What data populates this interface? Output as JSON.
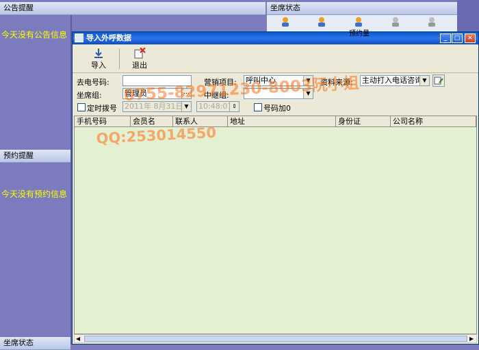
{
  "left": {
    "announcement_header": "公告提醒",
    "announcement_text": "今天没有公告信息",
    "reservation_header": "预约提醒",
    "reservation_text": "今天没有预约信息",
    "bottom_header": "坐席状态"
  },
  "agents": {
    "header": "坐席状态",
    "icons": [
      "agent-online-icon",
      "agent-online-icon",
      "agent-online-icon",
      "agent-offline-icon",
      "agent-offline-icon"
    ],
    "labels": [
      "",
      "",
      "预约量",
      "",
      ""
    ]
  },
  "dialog": {
    "title": "导入外呼数据",
    "toolbar": {
      "import_label": "导入",
      "exit_label": "退出"
    },
    "form": {
      "phone_label": "去电号码:",
      "phone_value": "",
      "marketing_label": "营销项目:",
      "marketing_value": "呼叫中心",
      "source_label": "资料来源:",
      "source_value": "主动打入电话咨询",
      "group_label": "坐席组:",
      "group_value": "管理员",
      "trunk_label": "中继组:",
      "trunk_value": "",
      "timed_dial_label": "定时拨号",
      "timed_date_value": "2011年 8月31日",
      "timed_time_value": "10:48:07",
      "add_prefix_label": "号码加0"
    },
    "grid": {
      "columns": [
        "手机号码",
        "会员名",
        "联系人",
        "地址",
        "身份证",
        "公司名称"
      ]
    }
  },
  "watermark": {
    "phone_text": "0755-82971230-8003阮小姐",
    "qq_text": "QQ:253014550"
  },
  "colors": {
    "desktop_bg": "#7b7bbd",
    "notice_text": "#ffff00",
    "grid_bg": "#e4f0d2",
    "titlebar": "#0a58d6",
    "watermark": "#ff6e14"
  }
}
